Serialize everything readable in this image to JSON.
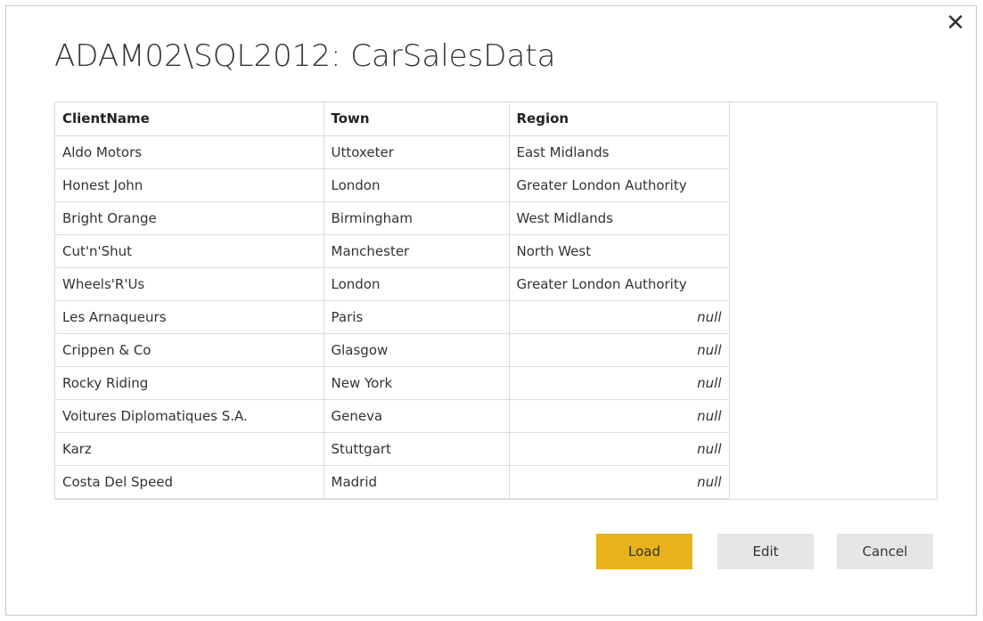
{
  "dialog": {
    "title": "ADAM02\\SQL2012: CarSalesData",
    "close_label": "✕"
  },
  "table": {
    "columns": [
      "ClientName",
      "Town",
      "Region"
    ],
    "rows": [
      [
        "Aldo Motors",
        "Uttoxeter",
        "East Midlands"
      ],
      [
        "Honest John",
        "London",
        "Greater London Authority"
      ],
      [
        "Bright Orange",
        "Birmingham",
        "West Midlands"
      ],
      [
        "Cut'n'Shut",
        "Manchester",
        "North West"
      ],
      [
        "Wheels'R'Us",
        "London",
        "Greater London Authority"
      ],
      [
        "Les Arnaqueurs",
        "Paris",
        "null"
      ],
      [
        "Crippen & Co",
        "Glasgow",
        "null"
      ],
      [
        "Rocky Riding",
        "New York",
        "null"
      ],
      [
        "Voitures Diplomatiques S.A.",
        "Geneva",
        "null"
      ],
      [
        "Karz",
        "Stuttgart",
        "null"
      ],
      [
        "Costa Del Speed",
        "Madrid",
        "null"
      ]
    ]
  },
  "buttons": {
    "load": "Load",
    "edit": "Edit",
    "cancel": "Cancel"
  },
  "colors": {
    "load_button": "#e9b21a",
    "secondary_button": "#e6e6e6"
  }
}
